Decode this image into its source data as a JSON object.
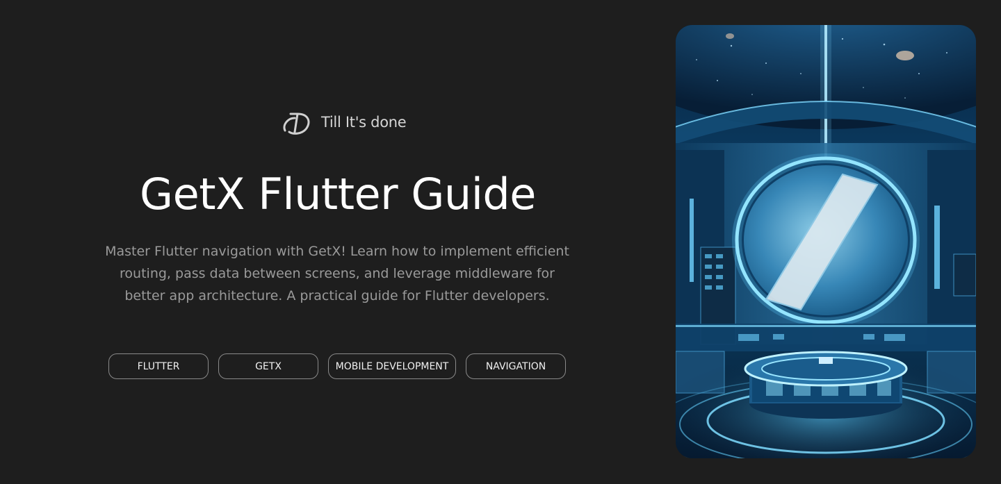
{
  "brand": {
    "logo_icon": "brand-logo-icon",
    "name": "Till It's done"
  },
  "hero": {
    "title": "GetX Flutter Guide",
    "description": "Master Flutter navigation with GetX! Learn how to implement efficient routing, pass data between screens, and leverage middleware for better app architecture. A practical guide for Flutter developers."
  },
  "tags": [
    {
      "label": "FLUTTER"
    },
    {
      "label": "GETX"
    },
    {
      "label": "MOBILE DEVELOPMENT"
    },
    {
      "label": "NAVIGATION"
    }
  ],
  "cover_image": {
    "icon": "sci-fi-chamber-illustration"
  },
  "colors": {
    "background": "#1e1e1e",
    "title": "#ffffff",
    "description": "#9a9a9a",
    "tag_border": "#8a8a8a",
    "accent_glow": "#4fc3f7"
  }
}
